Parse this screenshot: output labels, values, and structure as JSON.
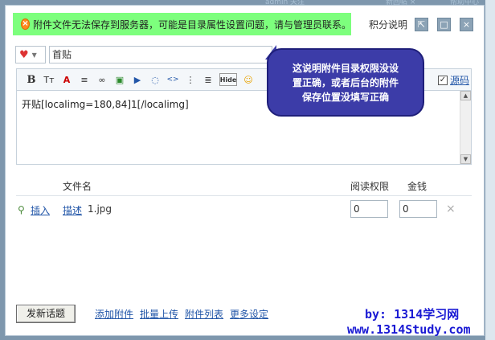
{
  "top_strip": {
    "left_fragment": "admin 关注",
    "mid_fragment": "新回帖 ×",
    "right_fragment": "帮助中心"
  },
  "error": {
    "icon": "error-circle-icon",
    "message": "附件文件无法保存到服务器，可能是目录属性设置问题，请与管理员联系。"
  },
  "header": {
    "score_label": "积分说明",
    "popout_icon": "popout-icon",
    "maximize_icon": "maximize-icon",
    "close_icon": "close-icon"
  },
  "subject": {
    "emote_icon": "heart-icon",
    "value": "首贴"
  },
  "toolbar": {
    "buttons": [
      "B",
      "Tт",
      "A",
      "≡",
      "∞",
      "▣",
      "▶",
      "◌",
      "<>",
      "⋮",
      "≣",
      "Hide",
      "☺"
    ],
    "source_label": "源码",
    "source_checked": "✓"
  },
  "editor": {
    "content": "开贴[localimg=180,84]1[/localimg]"
  },
  "files": {
    "col_name": "文件名",
    "col_perm": "阅读权限",
    "col_money": "金钱",
    "rows": [
      {
        "insert": "插入",
        "describe": "描述",
        "name": "1.jpg",
        "perm": "0",
        "money": "0",
        "remove": "×"
      }
    ]
  },
  "tooltip": {
    "text": "这说明附件目录权限没设\n置正确，或者后台的附件\n保存位置没填写正确"
  },
  "footer": {
    "submit": "发新话题",
    "links": [
      "添加附件",
      "批量上传",
      "附件列表",
      "更多设定"
    ]
  },
  "watermark": {
    "line1": "by: 1314学习网",
    "line2": "www.1314Study.com"
  }
}
